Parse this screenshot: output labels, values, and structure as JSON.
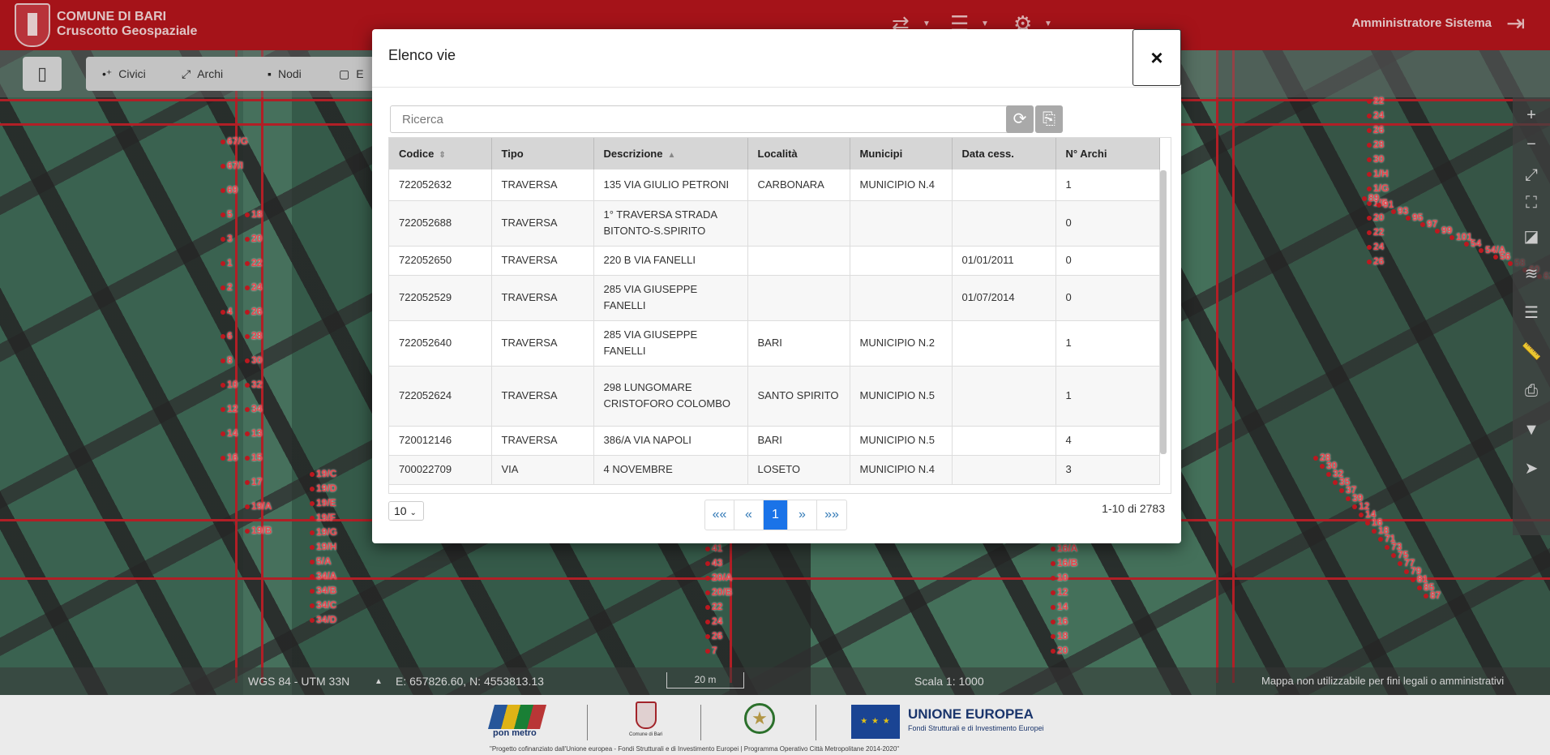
{
  "header": {
    "brand_line1": "COMUNE DI BARI",
    "brand_line2": "Cruscotto Geospaziale",
    "user": "Amministratore Sistema",
    "icons": [
      "signpost-icon",
      "network-icon",
      "settings-icon"
    ],
    "accent_color": "#b3151c"
  },
  "toolbar": {
    "buttons": [
      {
        "label": "Civici",
        "icon": "point-icon"
      },
      {
        "label": "Archi",
        "icon": "arc-icon"
      },
      {
        "label": "Nodi",
        "icon": "node-icon"
      },
      {
        "label": "E",
        "icon": "area-icon"
      }
    ]
  },
  "map": {
    "status": {
      "crs": "WGS 84 - UTM 33N",
      "coordinates": "E: 657826.60, N: 4553813.13",
      "scalebar": "20 m",
      "scale": "Scala 1: 1000",
      "disclaimer": "Mappa non utilizzabile per fini legali o amministrativi"
    },
    "rail_icons": [
      "zoom-in-icon",
      "zoom-out-icon",
      "extent-icon",
      "fullscreen-icon",
      "overview-icon",
      "layers-icon",
      "legend-icon",
      "measure-icon",
      "print-icon",
      "filter-icon",
      "select-icon"
    ],
    "labels": [
      "67/G",
      "67/I",
      "69",
      "5",
      "3",
      "1",
      "2",
      "4",
      "6",
      "8",
      "10",
      "12",
      "14",
      "16",
      "18",
      "20",
      "22",
      "24",
      "26",
      "28",
      "30",
      "32",
      "34",
      "13",
      "15",
      "17",
      "19/A",
      "19/B",
      "19/C",
      "19/D",
      "19/E",
      "19/F",
      "19/G",
      "19/H",
      "5/A",
      "34/A",
      "34/B",
      "34/C",
      "34/D",
      "36",
      "38",
      "37",
      "39",
      "41",
      "43",
      "20/A",
      "20/B",
      "22",
      "24",
      "26",
      "7",
      "9",
      "11",
      "13",
      "15",
      "16/A",
      "16/B",
      "10",
      "12",
      "14",
      "16",
      "18",
      "20",
      "22",
      "24",
      "26",
      "28",
      "30",
      "1/H",
      "1/G",
      "1/F",
      "20",
      "22",
      "24",
      "26",
      "28",
      "30",
      "32",
      "35",
      "37",
      "39",
      "12",
      "14",
      "16",
      "18",
      "71",
      "73",
      "75",
      "77",
      "79",
      "81",
      "85",
      "87",
      "89",
      "91",
      "93",
      "95",
      "97",
      "99",
      "101",
      "54",
      "54/A",
      "56",
      "58",
      "60",
      "62",
      "64",
      "68",
      "70"
    ]
  },
  "modal": {
    "title": "Elenco vie",
    "close": "×",
    "search_placeholder": "Ricerca",
    "columns": [
      "Codice",
      "Tipo",
      "Descrizione",
      "Località",
      "Municipi",
      "Data cess.",
      "N° Archi"
    ],
    "rows": [
      [
        "722052632",
        "TRAVERSA",
        "135 VIA GIULIO PETRONI",
        "CARBONARA",
        "MUNICIPIO N.4",
        "",
        "1"
      ],
      [
        "722052688",
        "TRAVERSA",
        "1° TRAVERSA STRADA BITONTO-S.SPIRITO",
        "",
        "",
        "",
        "0"
      ],
      [
        "722052650",
        "TRAVERSA",
        "220 B VIA FANELLI",
        "",
        "",
        "01/01/2011",
        "0"
      ],
      [
        "722052529",
        "TRAVERSA",
        "285 VIA GIUSEPPE FANELLI",
        "",
        "",
        "01/07/2014",
        "0"
      ],
      [
        "722052640",
        "TRAVERSA",
        "285 VIA GIUSEPPE FANELLI",
        "BARI",
        "MUNICIPIO N.2",
        "",
        "1"
      ],
      [
        "722052624",
        "TRAVERSA",
        "298 LUNGOMARE CRISTOFORO COLOMBO",
        "SANTO SPIRITO",
        "MUNICIPIO N.5",
        "",
        "1"
      ],
      [
        "720012146",
        "TRAVERSA",
        "386/A VIA NAPOLI",
        "BARI",
        "MUNICIPIO N.5",
        "",
        "4"
      ],
      [
        "700022709",
        "VIA",
        "4 NOVEMBRE",
        "LOSETO",
        "MUNICIPIO N.4",
        "",
        "3"
      ]
    ],
    "page_size": "10",
    "pager": {
      "first": "««",
      "prev": "«",
      "current": "1",
      "next": "»",
      "last": "»»"
    },
    "page_info": "1-10 di 2783"
  },
  "footer": {
    "ponmetro": "pon metro",
    "crest_caption": "Comune di Bari",
    "eu_title": "UNIONE EUROPEA",
    "eu_subtitle": "Fondi Strutturali e di Investimento Europei",
    "note": "\"Progetto cofinanziato dall'Unione europea - Fondi Strutturali e di Investimento Europei | Programma Operativo Città Metropolitane 2014-2020\""
  }
}
